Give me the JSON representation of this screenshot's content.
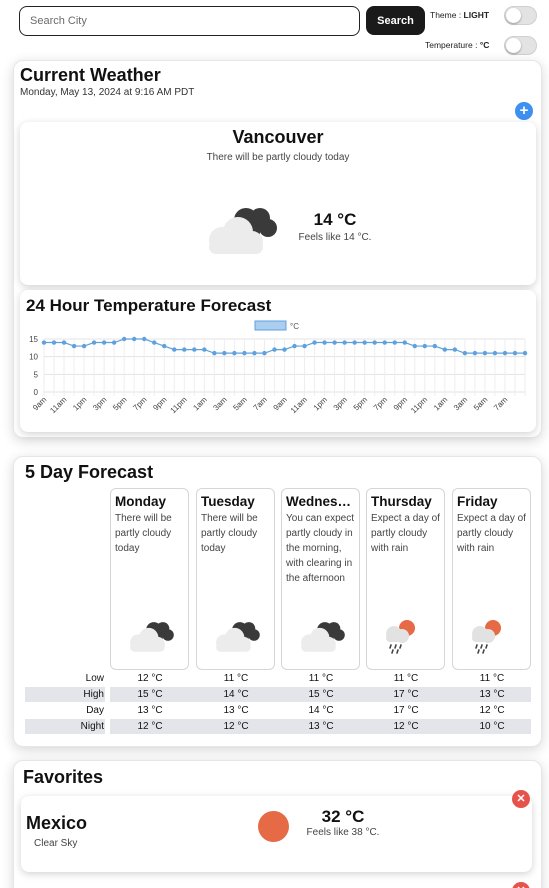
{
  "search": {
    "placeholder": "Search City",
    "value": "",
    "button_label": "Search"
  },
  "settings": {
    "theme_label": "Theme : ",
    "theme_value": "LIGHT",
    "temp_label": "Temperature : ",
    "temp_value": "°C"
  },
  "current": {
    "title": "Current Weather",
    "datetime": "Monday, May 13, 2024 at 9:16 AM PDT",
    "city": "Vancouver",
    "summary": "There will be partly cloudy today",
    "temp": "14 °C",
    "feels_like": "Feels like 14 °C.",
    "icon": "cloudy-icon"
  },
  "hourly": {
    "title": "24 Hour Temperature Forecast",
    "legend": "°C",
    "series_color": "#5fa1dc",
    "chart_data": {
      "type": "line",
      "series": [
        {
          "name": "°C",
          "values": [
            14,
            14,
            14,
            13,
            13,
            14,
            14,
            14,
            15,
            15,
            15,
            14,
            13,
            12,
            12,
            12,
            12,
            11,
            11,
            11,
            11,
            11,
            11,
            12,
            12,
            13,
            13,
            14,
            14,
            14,
            14,
            14,
            14,
            14,
            14,
            14,
            14,
            13,
            13,
            13,
            12,
            12,
            11,
            11,
            11,
            11,
            11,
            11,
            11
          ]
        }
      ],
      "ylim": [
        0,
        15
      ],
      "yticks": [
        0,
        5,
        10,
        15
      ],
      "xtick_labels": [
        "9am",
        "11am",
        "1pm",
        "3pm",
        "5pm",
        "7pm",
        "9pm",
        "11pm",
        "1am",
        "3am",
        "5am",
        "7am",
        "9am",
        "11am",
        "1pm",
        "3pm",
        "5pm",
        "7pm",
        "9pm",
        "11pm",
        "1am",
        "3am",
        "5am",
        "7am"
      ],
      "grid": true,
      "legend_position": "top-center"
    }
  },
  "five_day": {
    "title": "5 Day Forecast",
    "row_labels": [
      "Low",
      "High",
      "Day",
      "Night"
    ],
    "days": [
      {
        "name": "Monday",
        "desc": "There will be partly cloudy today",
        "icon": "cloudy-icon",
        "low": "12 °C",
        "high": "15 °C",
        "day": "13 °C",
        "night": "12 °C"
      },
      {
        "name": "Tuesday",
        "desc": "There will be partly cloudy today",
        "icon": "cloudy-icon",
        "low": "11 °C",
        "high": "14 °C",
        "day": "13 °C",
        "night": "12 °C"
      },
      {
        "name": "Wednesd...",
        "desc": "You can expect partly cloudy in the morning, with clearing in the afternoon",
        "icon": "cloudy-icon",
        "low": "11 °C",
        "high": "15 °C",
        "day": "14 °C",
        "night": "13 °C"
      },
      {
        "name": "Thursday",
        "desc": "Expect a day of partly cloudy with rain",
        "icon": "rain-sun-icon",
        "low": "11 °C",
        "high": "17 °C",
        "day": "17 °C",
        "night": "12 °C"
      },
      {
        "name": "Friday",
        "desc": "Expect a day of partly cloudy with rain",
        "icon": "rain-sun-icon",
        "low": "11 °C",
        "high": "13 °C",
        "day": "12 °C",
        "night": "10 °C"
      }
    ]
  },
  "favorites": {
    "title": "Favorites",
    "items": [
      {
        "city": "Mexico",
        "summary": "Clear Sky",
        "temp": "32 °C",
        "feels_like": "Feels like 38 °C.",
        "icon": "sun-icon"
      }
    ]
  },
  "colors": {
    "accent_blue": "#3d8ff0",
    "remove_red": "#e5534b",
    "sun_orange": "#e56a45",
    "band_grey": "#e4e5ea"
  }
}
